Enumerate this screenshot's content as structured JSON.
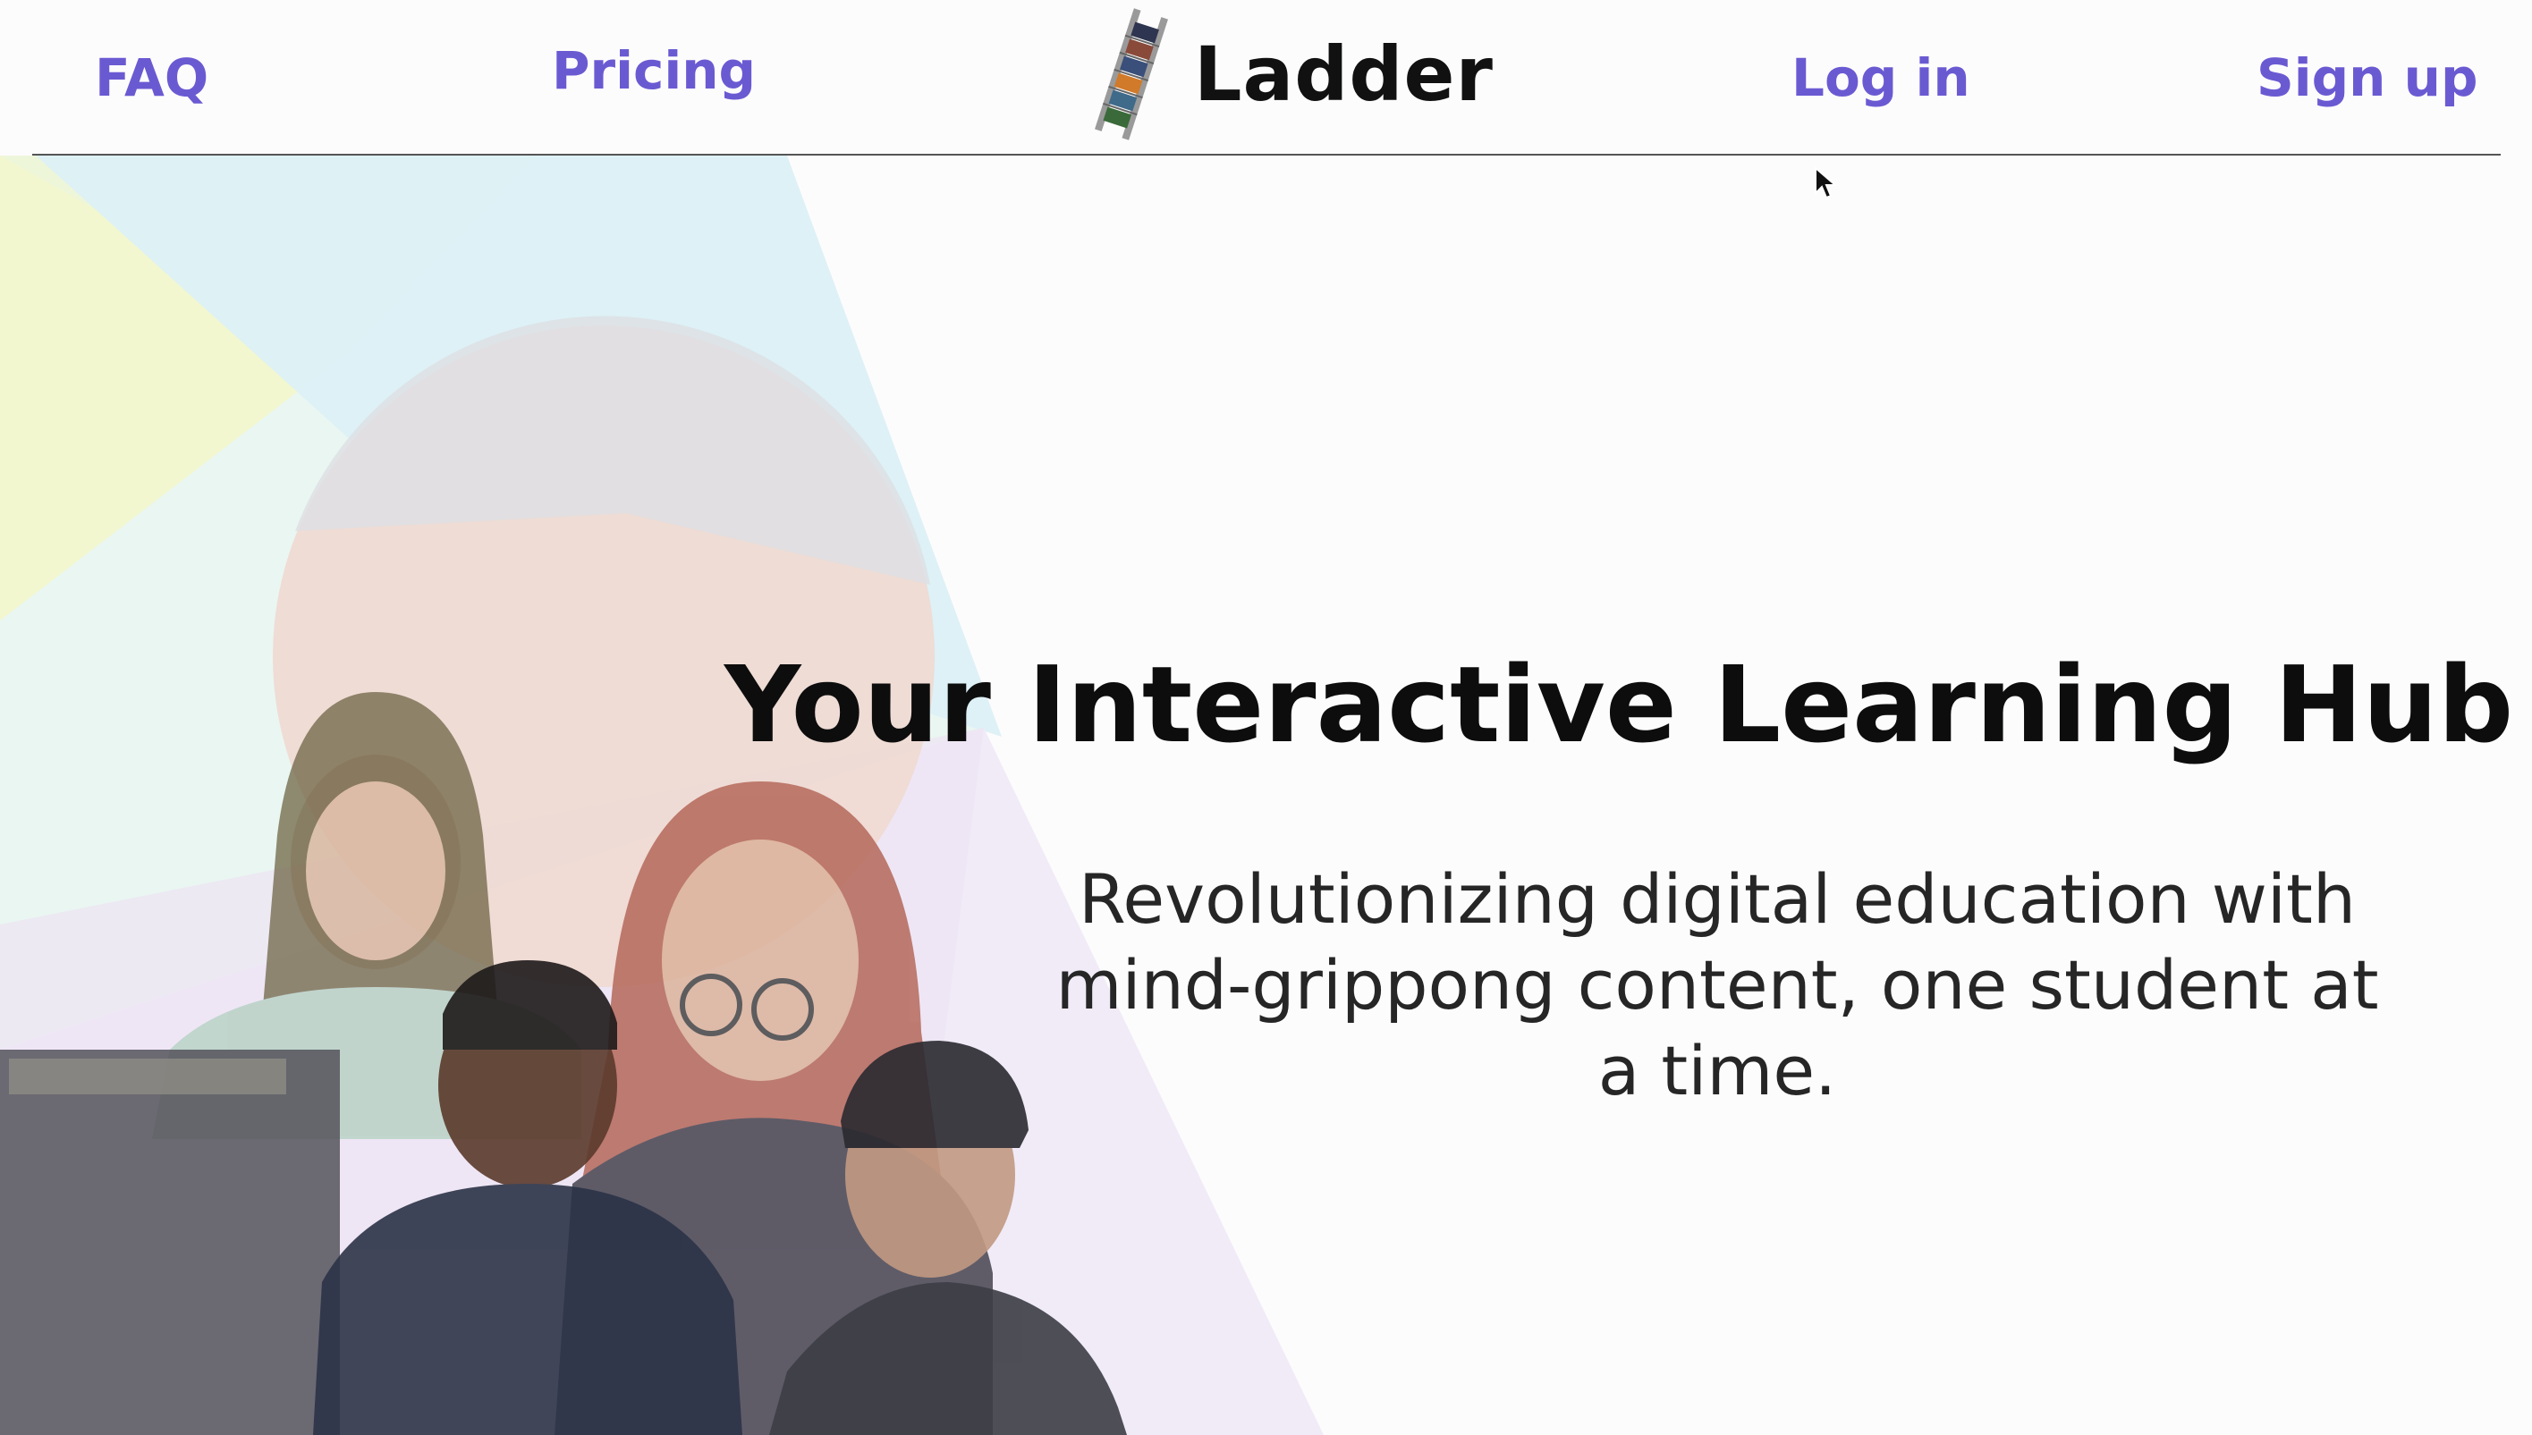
{
  "header": {
    "nav_left": [
      {
        "label": "FAQ"
      },
      {
        "label": "Pricing"
      }
    ],
    "logo_text": "Ladder",
    "nav_right": [
      {
        "label": "Log in"
      },
      {
        "label": "Sign up"
      }
    ]
  },
  "hero": {
    "title": "Your Interactive Learning Hub",
    "subtitle": "Revolutionizing digital education with mind-grippong content, one student at a time."
  },
  "colors": {
    "nav_link": "#6a5ad2",
    "title": "#0d0d0d",
    "background": "#fdfcfc"
  },
  "icons": {
    "logo": "ladder-icon",
    "cursor": "mouse-pointer-icon"
  }
}
